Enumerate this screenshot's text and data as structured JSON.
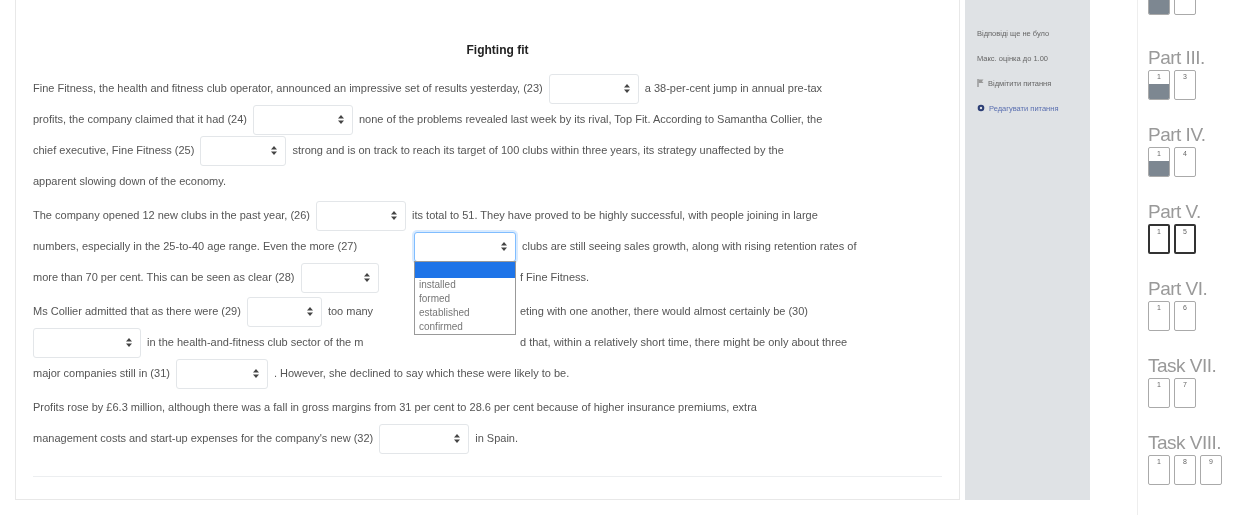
{
  "article": {
    "title": "Fighting fit",
    "paragraphs": [
      {
        "lines": [
          {
            "kind": "flow",
            "parts": [
              {
                "kind": "text",
                "text": "Fine Fitness, the health and fitness club operator, announced an impressive set of results yesterday, (23)"
              },
              {
                "kind": "select",
                "open": false
              },
              {
                "kind": "text",
                "text": "a 38-per-cent jump in annual pre-tax"
              }
            ]
          },
          {
            "kind": "flow",
            "parts": [
              {
                "kind": "text",
                "text": "profits, the company claimed that it had (24)"
              },
              {
                "kind": "select",
                "open": false
              },
              {
                "kind": "text",
                "text": "none of the problems revealed last week by its rival, Top Fit. According to Samantha Collier, the"
              }
            ]
          },
          {
            "kind": "flow",
            "parts": [
              {
                "kind": "text",
                "text": "chief executive, Fine Fitness (25)"
              },
              {
                "kind": "select",
                "open": false
              },
              {
                "kind": "text",
                "text": "strong and is on track to reach its target of 100 clubs within three years, its strategy unaffected by the"
              }
            ]
          },
          {
            "kind": "flow",
            "parts": [
              {
                "kind": "text",
                "text": "apparent slowing down of the economy."
              }
            ]
          }
        ]
      },
      {
        "lines": [
          {
            "kind": "flow",
            "parts": [
              {
                "kind": "text",
                "text": "The company opened 12 new clubs in the past year, (26)"
              },
              {
                "kind": "select",
                "open": false
              },
              {
                "kind": "text",
                "text": "its total to 51. They have proved to be highly successful, with people joining in large"
              }
            ]
          },
          {
            "kind": "split",
            "left": [
              {
                "kind": "text",
                "text": "numbers, especially in the 25-to-40 age range. Even the more (27)"
              }
            ],
            "right": [
              {
                "kind": "select",
                "open": true,
                "options": [
                  {
                    "selected": true
                  },
                  {
                    "label": "installed",
                    "selected": false
                  },
                  {
                    "label": "formed",
                    "selected": false
                  },
                  {
                    "label": "established",
                    "selected": false
                  },
                  {
                    "label": "confirmed",
                    "selected": false
                  }
                ]
              },
              {
                "kind": "text",
                "text": "clubs are still seeing sales growth, along with rising retention rates of"
              }
            ]
          },
          {
            "kind": "split",
            "left": [
              {
                "kind": "text",
                "text": "more than 70 per cent. This can be seen as clear (28)"
              },
              {
                "kind": "select",
                "open": false
              }
            ],
            "right": [
              {
                "kind": "gap"
              },
              {
                "kind": "text",
                "text": "f Fine Fitness."
              }
            ]
          }
        ]
      },
      {
        "lines": [
          {
            "kind": "split",
            "left": [
              {
                "kind": "text",
                "text": "Ms Collier admitted that as there were (29)"
              },
              {
                "kind": "select",
                "open": false
              },
              {
                "kind": "text",
                "text": "too many"
              }
            ],
            "right": [
              {
                "kind": "gap"
              },
              {
                "kind": "text",
                "text": "eting with one another, there would almost certainly be (30)"
              }
            ]
          },
          {
            "kind": "split",
            "left": [
              {
                "kind": "select",
                "open": false
              },
              {
                "kind": "text",
                "text": "in the health-and-fitness club sector of the m"
              }
            ],
            "right": [
              {
                "kind": "gap"
              },
              {
                "kind": "text",
                "text": "d that, within a relatively short time, there might be only about three"
              }
            ]
          },
          {
            "kind": "flow",
            "parts": [
              {
                "kind": "text",
                "text": "major companies still in (31)"
              },
              {
                "kind": "select",
                "open": false
              },
              {
                "kind": "text",
                "text": ". However, she declined to say which these were likely to be."
              }
            ]
          }
        ]
      },
      {
        "lines": [
          {
            "kind": "flow",
            "parts": [
              {
                "kind": "text",
                "text": "Profits rose by £6.3 million, although there was a fall in gross margins from 31 per cent to 28.6 per cent because of higher insurance premiums, extra"
              }
            ]
          },
          {
            "kind": "flow",
            "parts": [
              {
                "kind": "text",
                "text": "management costs and start-up expenses for the company's new (32)"
              },
              {
                "kind": "select",
                "open": false
              },
              {
                "kind": "text",
                "text": "in Spain."
              }
            ]
          }
        ]
      }
    ]
  },
  "info_panel": {
    "items": [
      {
        "kind": "text",
        "text": "Відповіді ще не було"
      },
      {
        "kind": "text",
        "text": "Макс. оцінка до 1.00"
      },
      {
        "kind": "flag",
        "text": "Відмітити питання"
      },
      {
        "kind": "edit",
        "text": "Редагувати питання"
      }
    ]
  },
  "navigation": {
    "sections": [
      {
        "buttons": [
          {
            "answered": true,
            "current": false
          },
          {
            "answered": false,
            "current": false
          }
        ]
      },
      {
        "title": "Part III.",
        "buttons": [
          {
            "number": "1",
            "answered": true,
            "current": false
          },
          {
            "number": "3",
            "answered": false,
            "current": false
          }
        ]
      },
      {
        "title": "Part IV.",
        "buttons": [
          {
            "number": "1",
            "answered": true,
            "current": false
          },
          {
            "number": "4",
            "answered": false,
            "current": false
          }
        ]
      },
      {
        "title": "Part V.",
        "buttons": [
          {
            "number": "1",
            "answered": false,
            "current": true
          },
          {
            "number": "5",
            "answered": false,
            "current": true
          }
        ]
      },
      {
        "title": "Part VI.",
        "buttons": [
          {
            "number": "1",
            "answered": false,
            "current": false
          },
          {
            "number": "6",
            "answered": false,
            "current": false
          }
        ]
      },
      {
        "title": "Task VII.",
        "buttons": [
          {
            "number": "1",
            "answered": false,
            "current": false
          },
          {
            "number": "7",
            "answered": false,
            "current": false
          }
        ]
      },
      {
        "title": "Task VIII.",
        "buttons": [
          {
            "number": "1",
            "answered": false,
            "current": false
          },
          {
            "number": "8",
            "answered": false,
            "current": false
          },
          {
            "number": "9",
            "answered": false,
            "current": false
          }
        ]
      }
    ]
  }
}
